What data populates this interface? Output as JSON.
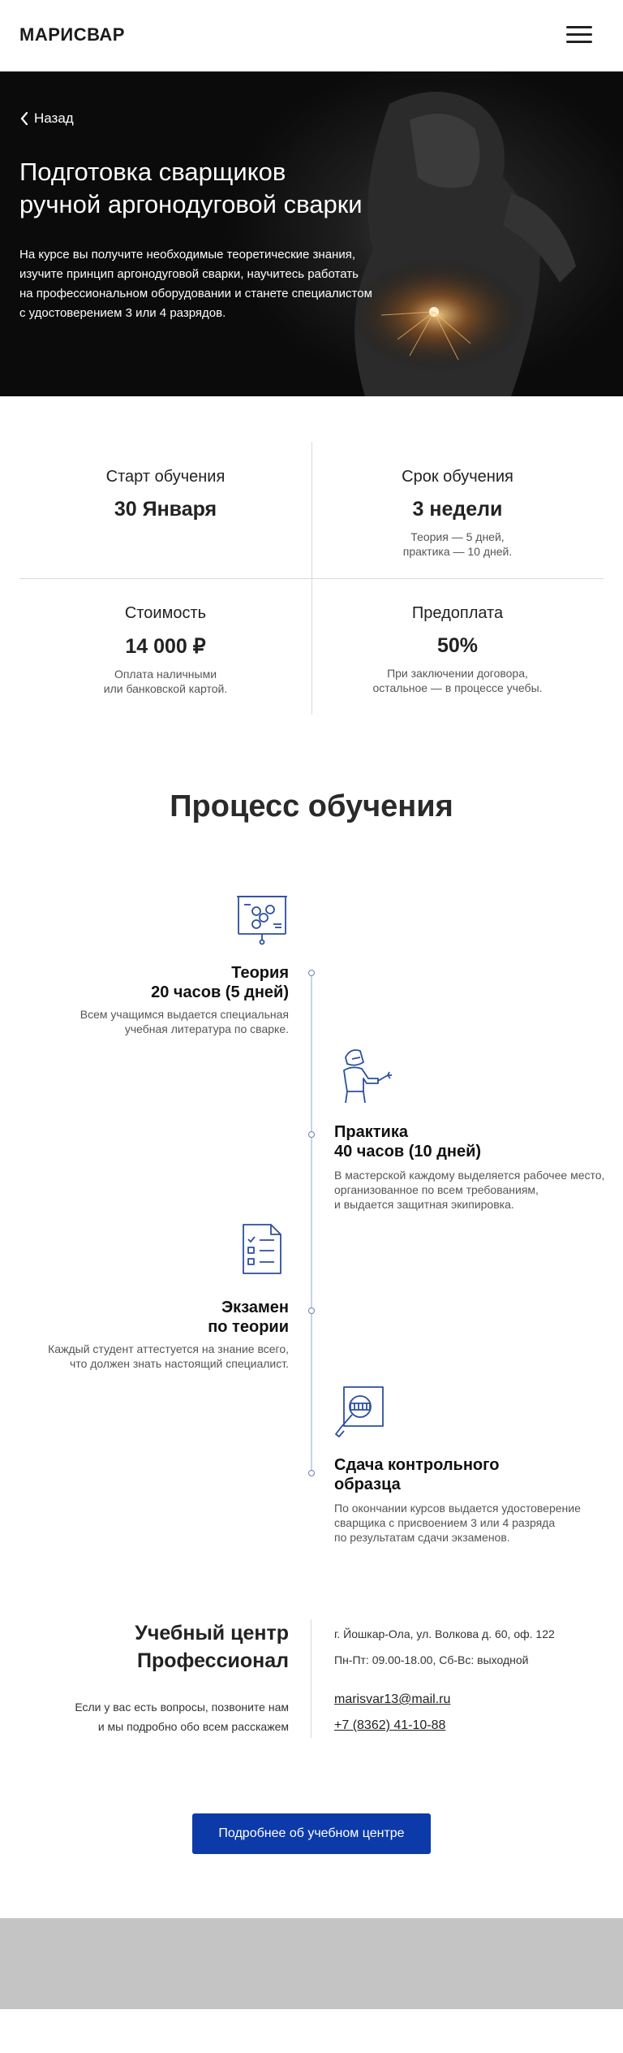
{
  "header": {
    "logo": "МАРИСВАР",
    "menu_icon": "hamburger-menu-icon"
  },
  "hero": {
    "back_label": "Назад",
    "back_icon": "chevron-left-icon",
    "title_line1": "Подготовка сварщиков",
    "title_line2": "ручной аргонодуговой сварки",
    "desc_lines": [
      "На курсе вы получите необходимые теоретические знания,",
      "изучите принцип аргонодуговой сварки, научитесь работать",
      "на профессиональном оборудовании и станете специалистом",
      "с удостоверением 3 или 4 разрядов."
    ]
  },
  "info": [
    {
      "title": "Старт обучения",
      "value": "30 Января",
      "note_lines": []
    },
    {
      "title": "Срок обучения",
      "value": "3 недели",
      "note_lines": [
        "Теория — 5 дней,",
        "практика — 10 дней."
      ]
    },
    {
      "title": "Стоимость",
      "value": "14 000 ₽",
      "note_lines": [
        "Оплата наличными",
        "или банковской картой."
      ]
    },
    {
      "title": "Предоплата",
      "value": "50%",
      "note_lines": [
        "При заключении договора,",
        "остальное — в процессе учебы."
      ]
    }
  ],
  "process": {
    "title": "Процесс обучения",
    "steps": [
      {
        "icon": "presentation-board-icon",
        "title_lines": [
          "Теория",
          "20 часов (5 дней)"
        ],
        "desc_lines": [
          "Всем учащимся выдается специальная",
          "учебная литература по сварке."
        ]
      },
      {
        "icon": "welder-icon",
        "title_lines": [
          "Практика",
          "40 часов (10 дней)"
        ],
        "desc_lines": [
          "В мастерской каждому выделяется рабочее место,",
          "организованное по всем требованиям,",
          "и выдается защитная экипировка."
        ]
      },
      {
        "icon": "checklist-document-icon",
        "title_lines": [
          "Экзамен",
          "по теории"
        ],
        "desc_lines": [
          "Каждый студент аттестуется на знание всего,",
          "что должен знать настоящий специалист."
        ]
      },
      {
        "icon": "magnifier-inspection-icon",
        "title_lines": [
          "Сдача контрольного",
          "образца"
        ],
        "desc_lines": [
          "По окончании курсов выдается удостоверение",
          "сварщика с присвоением 3 или 4 разряда",
          "по результатам сдачи экзаменов."
        ]
      }
    ]
  },
  "contacts": {
    "org_line1": "Учебный центр",
    "org_line2": "Профессионал",
    "note_line1": "Если у вас есть вопросы, позвоните нам",
    "note_line2": "и мы подробно обо всем расскажем",
    "address": "г. Йошкар-Ола, ул. Волкова д. 60, оф. 122",
    "hours": "Пн-Пт: 09.00-18.00, Сб-Вс: выходной",
    "email": "marisvar13@mail.ru",
    "phone": "+7 (8362) 41-10-88"
  },
  "cta": {
    "label": "Подробнее об учебном центре"
  },
  "colors": {
    "accent": "#0d3aa9",
    "icon_stroke": "#2d4f9e",
    "hero_bg": "#111111",
    "footer_bg": "#c4c4c4"
  }
}
